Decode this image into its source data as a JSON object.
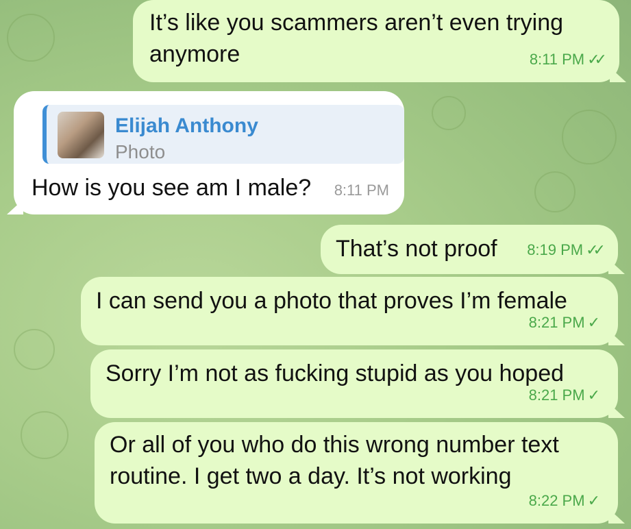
{
  "colors": {
    "outgoing_bubble": "#e5fbc8",
    "incoming_bubble": "#ffffff",
    "time_outgoing": "#4aa84a",
    "reply_accent": "#3f8fd6"
  },
  "messages": [
    {
      "id": "m1",
      "direction": "outgoing",
      "text": "It’s like you scammers aren’t even trying anymore",
      "time": "8:11 PM",
      "status": "read"
    },
    {
      "id": "m2",
      "direction": "incoming",
      "reply_to": {
        "name": "Elijah Anthony",
        "type": "Photo"
      },
      "text": "How is you see am I male?",
      "time": "8:11 PM"
    },
    {
      "id": "m3",
      "direction": "outgoing",
      "text": "That’s not proof",
      "time": "8:19 PM",
      "status": "read"
    },
    {
      "id": "m4",
      "direction": "outgoing",
      "text": "I can send you a photo that proves I’m female",
      "time": "8:21 PM",
      "status": "sent"
    },
    {
      "id": "m5",
      "direction": "outgoing",
      "text": "Sorry I’m not as fucking stupid as you hoped",
      "time": "8:21 PM",
      "status": "sent"
    },
    {
      "id": "m6",
      "direction": "outgoing",
      "text": "Or all of you who do this wrong number text routine. I get two a day. It’s not working",
      "time": "8:22 PM",
      "status": "sent"
    }
  ],
  "icons": {
    "read": "double-check-icon",
    "sent": "single-check-icon"
  }
}
